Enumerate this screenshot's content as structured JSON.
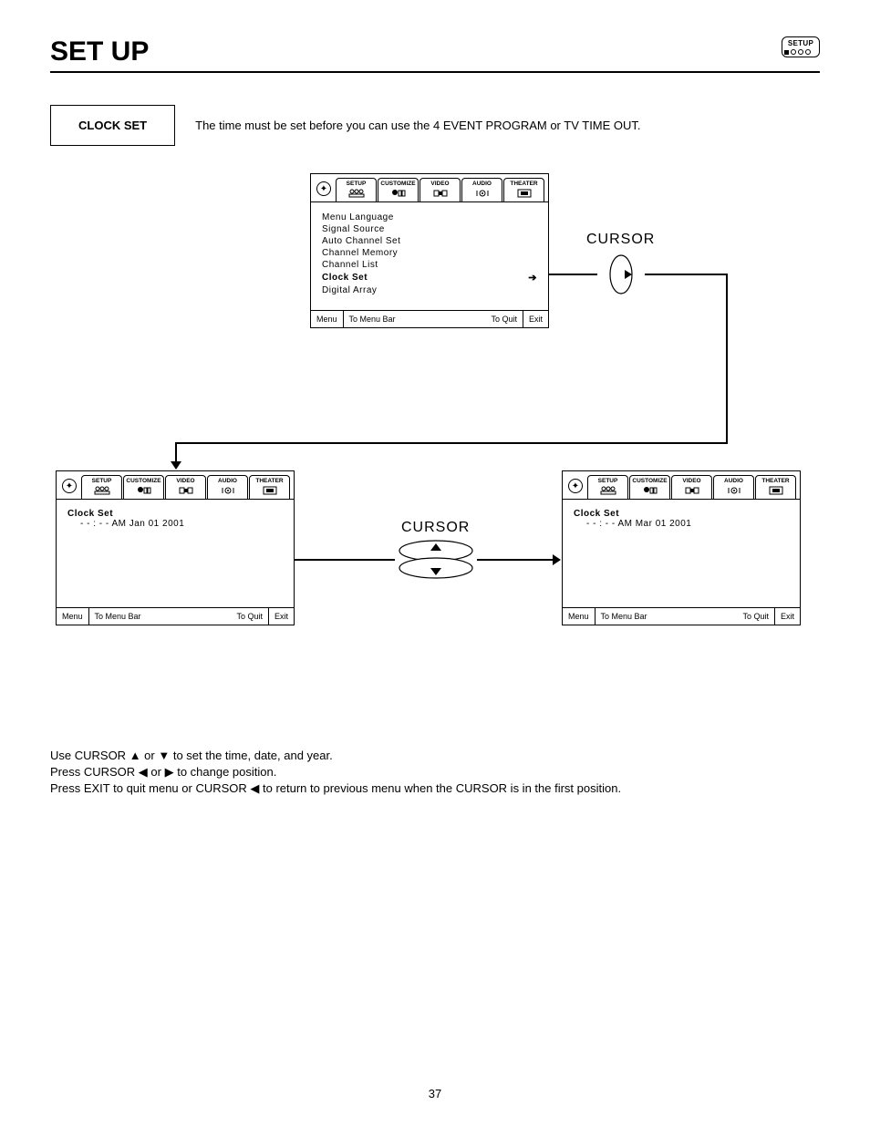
{
  "page_title": "SET UP",
  "badge": {
    "label": "SETUP"
  },
  "section_label": "CLOCK SET",
  "section_desc": "The time must be set before you can use the 4 EVENT PROGRAM or TV TIME OUT.",
  "tabs": {
    "setup": "SETUP",
    "customize": "CUSTOMIZE",
    "video": "VIDEO",
    "audio": "AUDIO",
    "theater": "THEATER"
  },
  "osd1": {
    "items": [
      "Menu Language",
      "Signal Source",
      "Auto Channel Set",
      "Channel Memory",
      "Channel List",
      "Clock Set",
      "Digital Array"
    ],
    "selected_index": 5
  },
  "osd2": {
    "title": "Clock Set",
    "value": "- - : - - AM Jan 01 2001"
  },
  "osd3": {
    "title": "Clock Set",
    "value": "- - : - - AM Mar 01 2001"
  },
  "footer": {
    "menu": "Menu",
    "to_menu_bar": "To Menu Bar",
    "to_quit": "To Quit",
    "exit": "Exit"
  },
  "cursor_label_1": "CURSOR",
  "cursor_label_2": "CURSOR",
  "instructions": {
    "l1_a": "Use CURSOR ",
    "l1_b": " or ",
    "l1_c": " to set the time, date, and year.",
    "l2_a": "Press CURSOR ",
    "l2_b": " or ",
    "l2_c": " to change position.",
    "l3_a": "Press EXIT to quit menu or CURSOR ",
    "l3_b": " to return to previous menu when the CURSOR is in the first position."
  },
  "glyph": {
    "up": "▲",
    "down": "▼",
    "left": "◀",
    "right": "▶"
  },
  "page_number": "37"
}
